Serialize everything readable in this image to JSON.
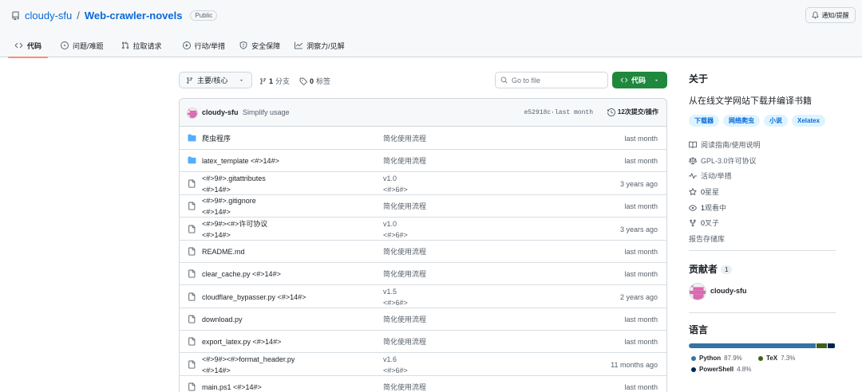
{
  "repo": {
    "owner": "cloudy-sfu",
    "separator": "/",
    "name": "Web-crawler-novels",
    "visibility": "Public"
  },
  "header": {
    "notify_label": "通知/提醒"
  },
  "tabs": [
    {
      "label": "代码",
      "icon": "code-icon",
      "active": true
    },
    {
      "label": "问题/难题",
      "icon": "issue-icon"
    },
    {
      "label": "拉取请求",
      "icon": "pull-request-icon"
    },
    {
      "label": "行动/举措",
      "icon": "play-icon"
    },
    {
      "label": "安全保障",
      "icon": "shield-icon"
    },
    {
      "label": "洞察力/见解",
      "icon": "graph-icon"
    }
  ],
  "toolbar": {
    "branch_label": "主要/核心",
    "branches_count": "1",
    "branches_label": "分支",
    "tags_count": "0",
    "tags_label": "标签",
    "search_placeholder": "Go to file",
    "code_button": "代码"
  },
  "commit": {
    "author": "cloudy-sfu",
    "message": "Simplify usage",
    "hash": "e52918c",
    "time": "last month",
    "hash_time": "e52918c·last month",
    "count_label": "12次提交/操作"
  },
  "files": [
    {
      "type": "folder",
      "name": "爬虫程序",
      "message": "简化使用流程",
      "date": "last month"
    },
    {
      "type": "folder",
      "name": "latex_template  <#>14#>",
      "message": "简化使用流程",
      "date": "last month"
    },
    {
      "type": "file",
      "name": "<#>9#>.gitattributes",
      "name2": "<#>14#>",
      "message": "v1.0",
      "message2": "<#>6#>",
      "date": "3 years ago"
    },
    {
      "type": "file",
      "name": "<#>9#>.gitignore",
      "name2": "<#>14#>",
      "message": "简化使用流程",
      "date": "last month"
    },
    {
      "type": "file",
      "name": "<#>9#><#>许可协议",
      "name2": "<#>14#>",
      "message": "v1.0",
      "message2": "<#>6#>",
      "date": "3 years ago"
    },
    {
      "type": "file",
      "name": "README.md",
      "message": "简化使用流程",
      "date": "last month"
    },
    {
      "type": "file",
      "name": "clear_cache.py  <#>14#>",
      "message": "简化使用流程",
      "date": "last month"
    },
    {
      "type": "file",
      "name": "cloudflare_bypasser.py  <#>14#>",
      "message": "v1.5",
      "message2": "<#>6#>",
      "date": "2 years ago"
    },
    {
      "type": "file",
      "name": "download.py",
      "message": "简化使用流程",
      "date": "last month"
    },
    {
      "type": "file",
      "name": "export_latex.py  <#>14#>",
      "message": "简化使用流程",
      "date": "last month"
    },
    {
      "type": "file",
      "name": "<#>9#><#>format_header.py",
      "name2": "<#>14#>",
      "message": "v1.6",
      "message2": "<#>6#>",
      "date": "11 months ago"
    },
    {
      "type": "file",
      "name": "main.ps1  <#>14#>",
      "message": "简化使用流程",
      "date": "last month"
    }
  ],
  "sidebar": {
    "about_title": "关于",
    "description": "从在线文学网站下载并编译书籍",
    "topics": [
      "下载器",
      "网络爬虫",
      "小说",
      "Xelatex"
    ],
    "links": [
      {
        "icon": "book-icon",
        "text": "阅读指南/使用说明"
      },
      {
        "icon": "scale-icon",
        "text": "GPL-3.0许可协议"
      },
      {
        "icon": "pulse-icon",
        "text": "活动/举措"
      },
      {
        "icon": "star-icon",
        "count": "0",
        "text": "星星"
      },
      {
        "icon": "eye-icon",
        "count": "1",
        "text": "观看中"
      },
      {
        "icon": "fork-icon",
        "count": "0",
        "text": "叉子"
      }
    ],
    "report_label": "报告存储库",
    "contributors_title": "贡献者",
    "contributors_count": "1",
    "contributor_name": "cloudy-sfu",
    "languages_title": "语言",
    "languages": [
      {
        "name": "Python",
        "percent": "87.9%",
        "value": 87.9,
        "color": "#3572A5"
      },
      {
        "name": "TeX",
        "percent": "7.3%",
        "value": 7.3,
        "color": "#3D6117"
      },
      {
        "name": "PowerShell",
        "percent": "4.8%",
        "value": 4.8,
        "color": "#012456"
      }
    ]
  }
}
